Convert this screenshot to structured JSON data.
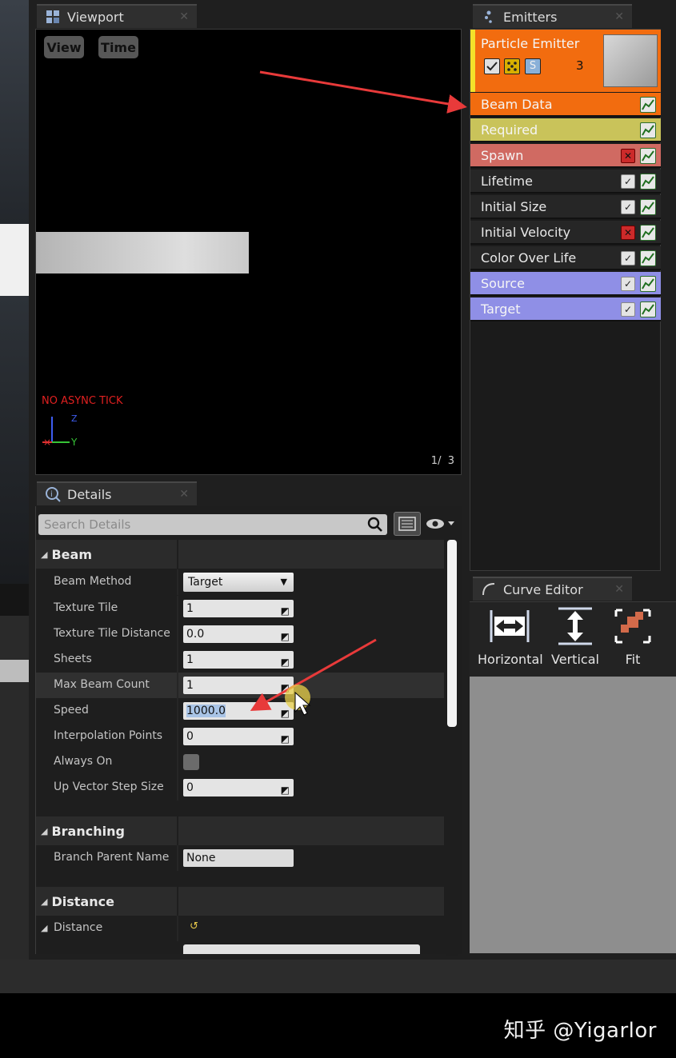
{
  "viewport": {
    "tab_label": "Viewport",
    "view_button": "View",
    "time_button": "Time",
    "async_text": "NO ASYNC TICK",
    "axis_z": "Z",
    "axis_y": "Y",
    "frame_current": "1/",
    "frame_total": "3"
  },
  "details": {
    "tab_label": "Details",
    "search_placeholder": "Search Details",
    "categories": {
      "beam": "Beam",
      "branching": "Branching",
      "distance": "Distance"
    },
    "beam_props": [
      {
        "label": "Beam Method",
        "value": "Target"
      },
      {
        "label": "Texture Tile",
        "value": "1"
      },
      {
        "label": "Texture Tile Distance",
        "value": "0.0"
      },
      {
        "label": "Sheets",
        "value": "1"
      },
      {
        "label": "Max Beam Count",
        "value": "1"
      },
      {
        "label": "Speed",
        "value": "1000.0"
      },
      {
        "label": "Interpolation Points",
        "value": "0"
      },
      {
        "label": "Always On",
        "value": ""
      },
      {
        "label": "Up Vector Step Size",
        "value": "0"
      }
    ],
    "branch_props": [
      {
        "label": "Branch Parent Name",
        "value": "None"
      }
    ],
    "distance_props": [
      {
        "label": "Distance",
        "value": ""
      }
    ]
  },
  "emitters": {
    "tab_label": "Emitters",
    "emitter_name": "Particle Emitter",
    "emitter_count": "3",
    "modules": [
      {
        "label": "Beam Data",
        "color": "#f26c0f",
        "text_color": "#f5f5f5",
        "enabled": null
      },
      {
        "label": "Required",
        "color": "#c9c35a",
        "text_color": "#f5f5f5",
        "enabled": null
      },
      {
        "label": "Spawn",
        "color": "#d06a62",
        "text_color": "#f5f5f5",
        "enabled": false
      },
      {
        "label": "Lifetime",
        "color": "#262626",
        "text_color": "#e8e8e8",
        "enabled": true
      },
      {
        "label": "Initial Size",
        "color": "#262626",
        "text_color": "#e8e8e8",
        "enabled": true
      },
      {
        "label": "Initial Velocity",
        "color": "#262626",
        "text_color": "#e8e8e8",
        "enabled": false
      },
      {
        "label": "Color Over Life",
        "color": "#262626",
        "text_color": "#e8e8e8",
        "enabled": true
      },
      {
        "label": "Source",
        "color": "#8f8fe6",
        "text_color": "#f5f5f5",
        "enabled": true
      },
      {
        "label": "Target",
        "color": "#8f8fe6",
        "text_color": "#f5f5f5",
        "enabled": true
      }
    ]
  },
  "curve_editor": {
    "tab_label": "Curve Editor",
    "horizontal": "Horizontal",
    "vertical": "Vertical",
    "fit": "Fit"
  },
  "watermark": "知乎 @Yigarlor"
}
